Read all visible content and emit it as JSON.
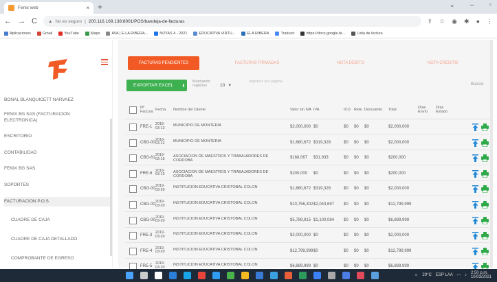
{
  "browser": {
    "tab_title": "Fenix web",
    "url_security": "No es seguro",
    "url": "200.116.169.138:8001/POS/bandeja-de-facturas",
    "bookmarks": [
      {
        "label": "Aplicaciones",
        "color": "#4a7bd0"
      },
      {
        "label": "Gmail",
        "color": "#d44638"
      },
      {
        "label": "YouTube",
        "color": "#e52d27"
      },
      {
        "label": "Maps",
        "color": "#3c9a4c"
      },
      {
        "label": "AVA | E-LA RIBERA...",
        "color": "#888888"
      },
      {
        "label": "NOTAS 4 - 2021",
        "color": "#1a73e8"
      },
      {
        "label": "EDUCATIVA VIRTU...",
        "color": "#5b8bd0"
      },
      {
        "label": "ELA RIBERA",
        "color": "#2d6fb7"
      },
      {
        "label": "Traducir",
        "color": "#4a8af4"
      },
      {
        "label": "https://docs.google.fe...",
        "color": "#333333"
      },
      {
        "label": "Lista de lectura",
        "color": "#555555"
      }
    ]
  },
  "sidebar": {
    "user_name": "BONAL BLANQUICETT NARVAEZ",
    "items": [
      {
        "label": "FENIX BG SAS (FACTURACION ELECTRONICA)",
        "sub": false,
        "active": false
      },
      {
        "label": "ESCRITORIO",
        "sub": false,
        "active": false
      },
      {
        "label": "CONTABILIDAD",
        "sub": false,
        "active": false
      },
      {
        "label": "FENIX BG SAS",
        "sub": false,
        "active": false
      },
      {
        "label": "SOPORTES",
        "sub": false,
        "active": false
      },
      {
        "label": "FACTURACION P.O.S.",
        "sub": false,
        "active": true
      },
      {
        "label": "CUADRE DE CAJA",
        "sub": true,
        "active": false
      },
      {
        "label": "CUADRE DE CAJA DETALLADO",
        "sub": true,
        "active": false
      },
      {
        "label": "COMPROBANTE DE EGRESO",
        "sub": true,
        "active": false
      }
    ]
  },
  "tabs": [
    {
      "label": "FACTURAS PENDIENTES",
      "active": true
    },
    {
      "label": "FACTURAS FIRMADAS",
      "active": false
    },
    {
      "label": "NOTA DEBITO",
      "active": false
    },
    {
      "label": "NOTA CREDITO",
      "active": false
    }
  ],
  "toolbar": {
    "export_label": "EXPORTAR EXCEL",
    "show_label": "Mostrando registros",
    "show_value": "10",
    "search_placeholder": "registros por pagina",
    "search_label": "Buscar"
  },
  "table": {
    "headers": {
      "num": "Nº Factura",
      "fecha": "Fecha",
      "cliente": "Nombre del Cliente",
      "valor": "Valor sin IVA",
      "iva": "IVA",
      "ico": "ICO",
      "rete": "Rete",
      "desc": "Descuento",
      "total": "Total",
      "dias_envio": "Días Envío",
      "dias_estado": "Días Estado"
    },
    "rows": [
      {
        "num": "FRE-1",
        "fecha": "2019-03-13",
        "cliente": "MUNICIPIO DE MONTERIA",
        "valor": "$2,000,000",
        "iva": "$0",
        "ico": "$0",
        "rete": "$0",
        "desc": "$0",
        "total": "$2,000,000"
      },
      {
        "num": "CBG-00",
        "fecha": "2019-03-12",
        "cliente": "MUNICIPIO DE MONTERIA",
        "valor": "$1,680,672",
        "iva": "$319,328",
        "ico": "$0",
        "rete": "$0",
        "desc": "$0",
        "total": "$2,000,000"
      },
      {
        "num": "CBG-61",
        "fecha": "2019-03-15",
        "cliente": "ASOCIACION DE MAESTROS Y TRABAJADORES DE CORDOBA",
        "valor": "$168,067",
        "iva": "$31,933",
        "ico": "$0",
        "rete": "$0",
        "desc": "$0",
        "total": "$200,000"
      },
      {
        "num": "FRE-6",
        "fecha": "2019-03-15",
        "cliente": "ASOCIACION DE MAESTROS Y TRABAJADORES DE CORDOBA",
        "valor": "$200,000",
        "iva": "$0",
        "ico": "$0",
        "rete": "$0",
        "desc": "$0",
        "total": "$200,000"
      },
      {
        "num": "CBG-00",
        "fecha": "2019-03-20",
        "cliente": "INSTITUCION EDUCATIVA CRISTOBAL COLON",
        "valor": "$1,680,672",
        "iva": "$319,328",
        "ico": "$0",
        "rete": "$0",
        "desc": "$0",
        "total": "$2,000,000"
      },
      {
        "num": "CBG-00",
        "fecha": "2019-03-20",
        "cliente": "INSTITUCION EDUCATIVA CRISTOBAL COLON",
        "valor": "$10,756,302",
        "iva": "$2,043,697",
        "ico": "$0",
        "rete": "$0",
        "desc": "$0",
        "total": "$12,799,999"
      },
      {
        "num": "CBG-00",
        "fecha": "2019-03-20",
        "cliente": "INSTITUCION EDUCATIVA CRISTOBAL COLON",
        "valor": "$5,789,915",
        "iva": "$1,100,084",
        "ico": "$0",
        "rete": "$0",
        "desc": "$0",
        "total": "$6,889,999"
      },
      {
        "num": "FRE-3",
        "fecha": "2019-03-20",
        "cliente": "INSTITUCION EDUCATIVA CRISTOBAL COLON",
        "valor": "$2,000,000",
        "iva": "$0",
        "ico": "$0",
        "rete": "$0",
        "desc": "$0",
        "total": "$2,000,000"
      },
      {
        "num": "FRE-4",
        "fecha": "2019-03-20",
        "cliente": "INSTITUCION EDUCATIVA CRISTOBAL COLON",
        "valor": "$12,799,999",
        "iva": "$0",
        "ico": "$0",
        "rete": "$0",
        "desc": "$0",
        "total": "$12,799,999"
      },
      {
        "num": "FRE-5",
        "fecha": "2019-03-20",
        "cliente": "INSTITUCION EDUCATIVA CRISTOBAL COLON",
        "valor": "$6,889,999",
        "iva": "$0",
        "ico": "$0",
        "rete": "$0",
        "desc": "$0",
        "total": "$6,889,999"
      }
    ]
  },
  "taskbar": {
    "weather": "29°C",
    "time": "2:50 p.m.",
    "date": "10/03/2021",
    "lang": "ESP LAA"
  },
  "colors": {
    "accent": "#f15a24",
    "export": "#3db050",
    "download": "#1e88d6",
    "print": "#2eaa4a"
  }
}
